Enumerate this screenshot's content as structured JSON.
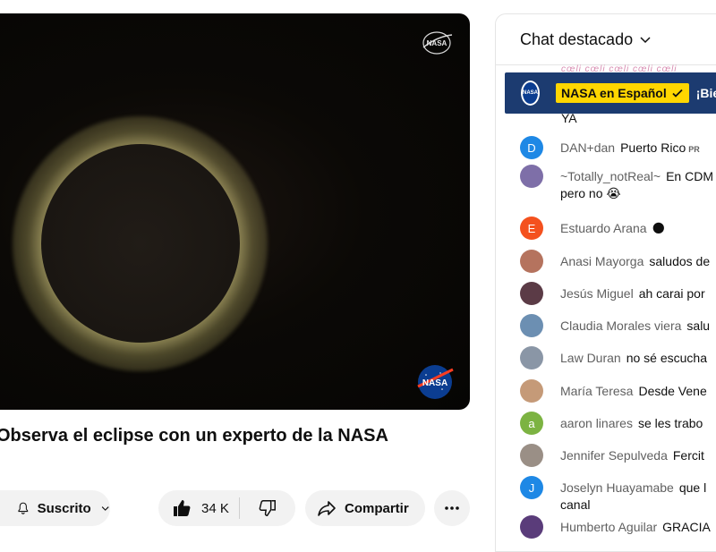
{
  "video": {
    "title": "Observa el eclipse con un experto de la NASA",
    "watermark_text": "NASA"
  },
  "actions": {
    "subscribe_label": "Suscrito",
    "like_count": "34 K",
    "share_label": "Compartir"
  },
  "chat": {
    "title": "Chat destacado",
    "pinned": {
      "author": "NASA en Español",
      "message": "¡Bie",
      "avatar_text": "NASA"
    },
    "orphan_line": "YA",
    "messages": [
      {
        "author": "DAN+dan",
        "text": "Puerto Rico",
        "flag": "PR",
        "avatar_letter": "D",
        "avatar_color": "#1e88e5"
      },
      {
        "author": "~Totally_notReal~",
        "text": "En CDM",
        "text2": "pero no 😭",
        "avatar_letter": "",
        "avatar_color": "#7e6fa8"
      },
      {
        "author": "Estuardo Arana",
        "text": "🌑",
        "avatar_letter": "E",
        "avatar_color": "#f4511e"
      },
      {
        "author": "Anasi Mayorga",
        "text": "saludos de",
        "avatar_letter": "",
        "avatar_color": "#b5735e"
      },
      {
        "author": "Jesús Miguel",
        "text": "ah carai por",
        "avatar_letter": "",
        "avatar_color": "#5b3b46"
      },
      {
        "author": "Claudia Morales viera",
        "text": "salu",
        "avatar_letter": "",
        "avatar_color": "#6c8fb2"
      },
      {
        "author": "Law Duran",
        "text": "no sé escucha",
        "avatar_letter": "",
        "avatar_color": "#8a96a6"
      },
      {
        "author": "María Teresa",
        "text": "Desde Vene",
        "avatar_letter": "",
        "avatar_color": "#c59a78"
      },
      {
        "author": "aaron linares",
        "text": "se les trabo",
        "avatar_letter": "a",
        "avatar_color": "#7cb342"
      },
      {
        "author": "Jennifer Sepulveda",
        "text": "Fercit",
        "avatar_letter": "",
        "avatar_color": "#9a8f86"
      },
      {
        "author": "Joselyn Huayamabe",
        "text": "que l",
        "text2": "canal",
        "avatar_letter": "J",
        "avatar_color": "#1e88e5"
      },
      {
        "author": "Humberto Aguilar",
        "text": "GRACIA",
        "avatar_letter": "",
        "avatar_color": "#5a3c7a"
      }
    ]
  },
  "colors": {
    "pinned_bg": "#1c3b70",
    "pinned_author_bg": "#ffd600",
    "pill_bg": "#f2f2f2"
  },
  "icons": [
    "nasa-logo-icon",
    "bell-icon",
    "chevron-down-icon",
    "thumbs-up-icon",
    "thumbs-down-icon",
    "share-icon",
    "more-icon",
    "verified-check-icon"
  ]
}
